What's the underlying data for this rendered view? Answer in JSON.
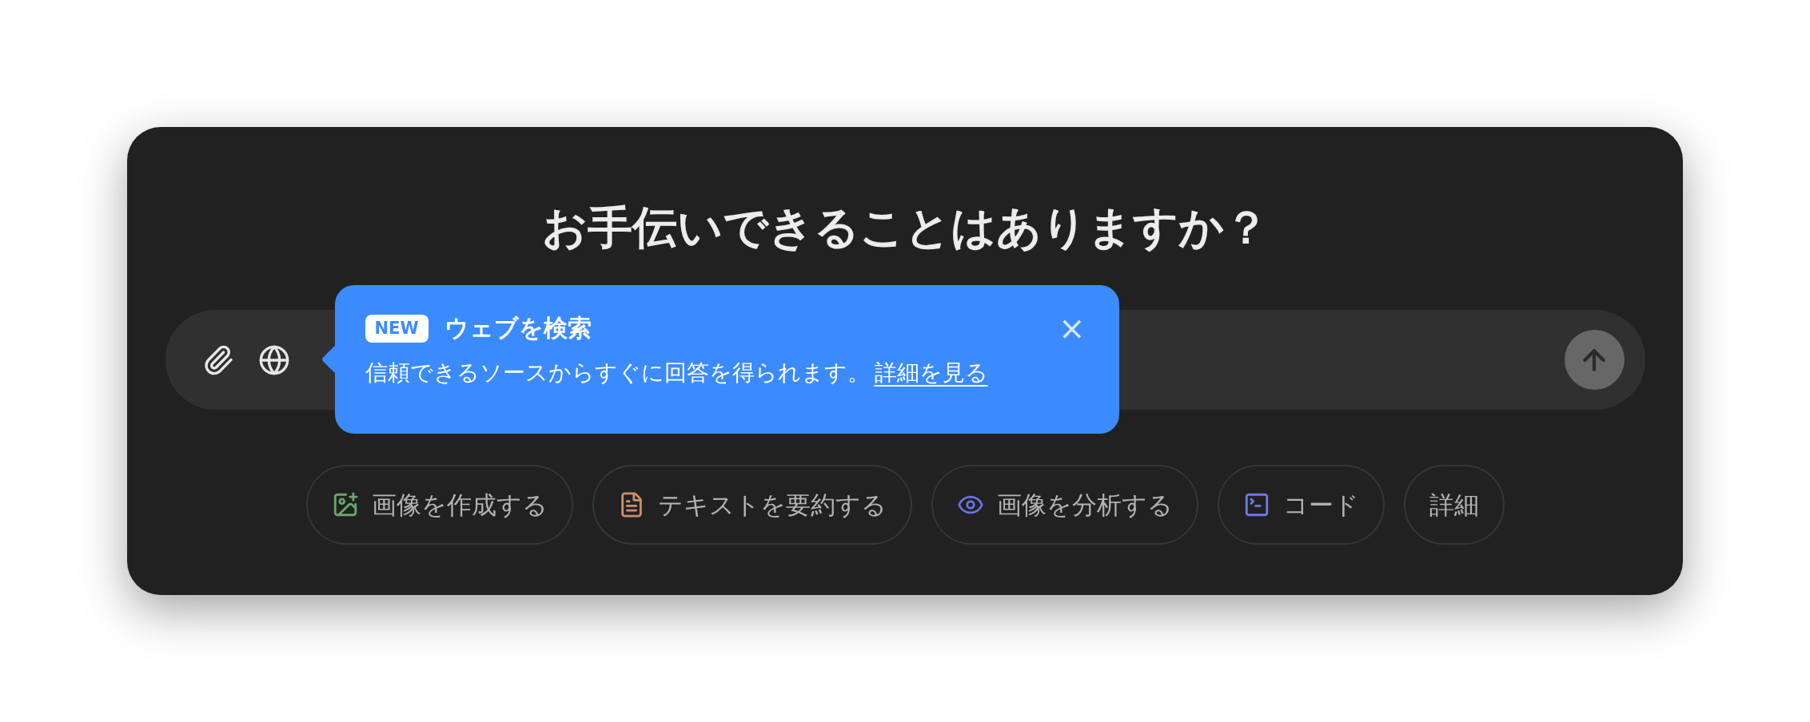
{
  "heading": "お手伝いできることはありますか？",
  "composer": {
    "tools": [
      {
        "kind": "attach"
      },
      {
        "kind": "web"
      }
    ],
    "send": {
      "disabled": true
    }
  },
  "tooltip": {
    "badge": "NEW",
    "title": "ウェブを検索",
    "close": "×",
    "body": "信頼できるソースからすぐに回答を得られます。",
    "link": "詳細を見る"
  },
  "chips": [
    {
      "kind": "image-create",
      "label": "画像を作成する",
      "color": "#6aa56f"
    },
    {
      "kind": "summary",
      "label": "テキストを要約する",
      "color": "#c98f6b"
    },
    {
      "kind": "analyze",
      "label": "画像を分析する",
      "color": "#6b72e6"
    },
    {
      "kind": "code",
      "label": "コード",
      "color": "#6b7be6"
    },
    {
      "kind": "none",
      "label": "詳細"
    }
  ]
}
